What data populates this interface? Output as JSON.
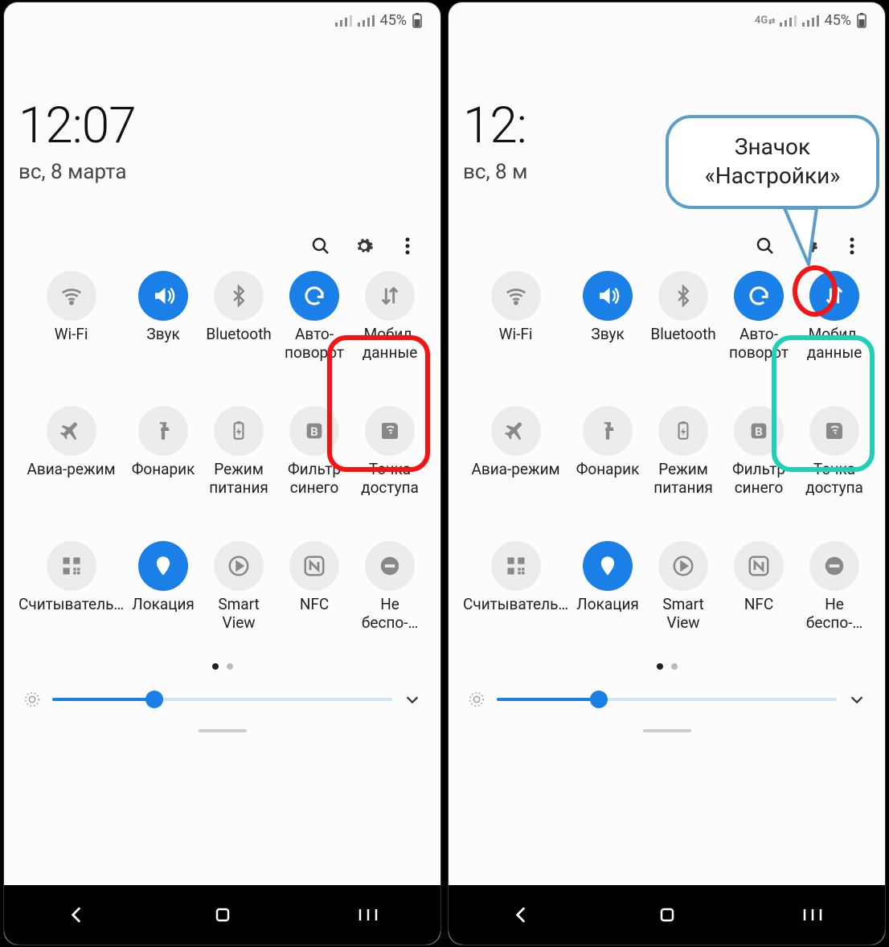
{
  "left": {
    "status": {
      "show4g": false,
      "battery_text": "45%"
    },
    "time": "12:07",
    "date": "вс, 8 марта",
    "tiles": [
      {
        "label": "Wi-Fi",
        "icon": "wifi",
        "active": false
      },
      {
        "label": "Звук",
        "icon": "sound",
        "active": true
      },
      {
        "label": "Bluetooth",
        "icon": "bt",
        "active": false
      },
      {
        "label": "Авто-поворот",
        "icon": "rotate",
        "active": true
      },
      {
        "label": "Мобил. данные",
        "icon": "data",
        "active": false
      },
      {
        "label": "Авиа-режим",
        "icon": "plane",
        "active": false
      },
      {
        "label": "Фонарик",
        "icon": "flash",
        "active": false
      },
      {
        "label": "Режим питания",
        "icon": "power",
        "active": false
      },
      {
        "label": "Фильтр синего",
        "icon": "bfilter",
        "active": false
      },
      {
        "label": "Точка доступа",
        "icon": "hotspot",
        "active": false
      },
      {
        "label": "Считыватель…",
        "icon": "qr",
        "active": false
      },
      {
        "label": "Локация",
        "icon": "loc",
        "active": true
      },
      {
        "label": "Smart View",
        "icon": "cast",
        "active": false
      },
      {
        "label": "NFC",
        "icon": "nfc",
        "active": false
      },
      {
        "label": "Не беспо-…",
        "icon": "dnd",
        "active": false
      }
    ],
    "brightness_pct": 30
  },
  "right": {
    "status": {
      "show4g": true,
      "battery_text": "45%"
    },
    "time": "12:",
    "date": "вс, 8 м",
    "callout_line1": "Значок",
    "callout_line2": "«Настройки»",
    "tiles": [
      {
        "label": "Wi-Fi",
        "icon": "wifi",
        "active": false
      },
      {
        "label": "Звук",
        "icon": "sound",
        "active": true
      },
      {
        "label": "Bluetooth",
        "icon": "bt",
        "active": false
      },
      {
        "label": "Авто-поворот",
        "icon": "rotate",
        "active": true
      },
      {
        "label": "Мобил. данные",
        "icon": "data",
        "active": true
      },
      {
        "label": "Авиа-режим",
        "icon": "plane",
        "active": false
      },
      {
        "label": "Фонарик",
        "icon": "flash",
        "active": false
      },
      {
        "label": "Режим питания",
        "icon": "power",
        "active": false
      },
      {
        "label": "Фильтр синего",
        "icon": "bfilter",
        "active": false
      },
      {
        "label": "Точка доступа",
        "icon": "hotspot",
        "active": false
      },
      {
        "label": "Считыватель…",
        "icon": "qr",
        "active": false
      },
      {
        "label": "Локация",
        "icon": "loc",
        "active": true
      },
      {
        "label": "Smart View",
        "icon": "cast",
        "active": false
      },
      {
        "label": "NFC",
        "icon": "nfc",
        "active": false
      },
      {
        "label": "Не беспо-…",
        "icon": "dnd",
        "active": false
      }
    ],
    "brightness_pct": 30
  }
}
